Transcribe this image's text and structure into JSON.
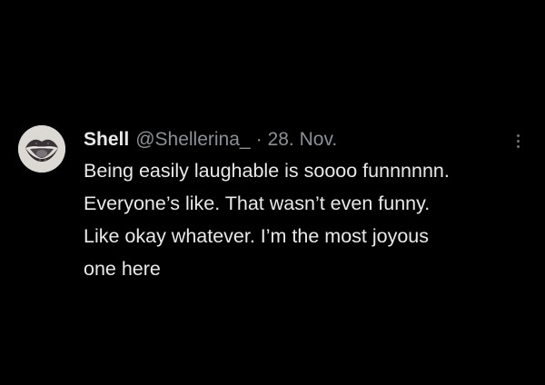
{
  "tweet": {
    "author": {
      "name": "Shell",
      "handle": "@Shellerina_",
      "avatar_icon": "lips-avatar-icon"
    },
    "separator": "·",
    "date": "28. Nov.",
    "more_icon": "more-options-icon",
    "text_lines": [
      "Being easily laughable is soooo funnnnnn.",
      "Everyone’s like. That wasn’t even funny.",
      "Like okay whatever. I’m the most joyous",
      "one here"
    ]
  },
  "colors": {
    "background": "#000000",
    "primary_text": "#e7e9ea",
    "secondary_text": "#8b9097"
  }
}
